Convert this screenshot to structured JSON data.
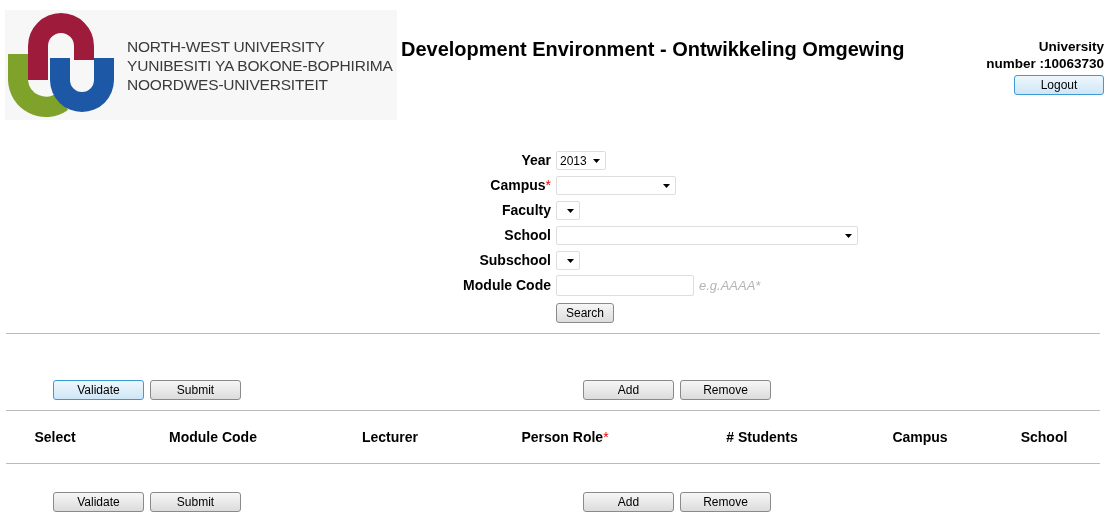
{
  "header": {
    "logo_lines": [
      "NORTH-WEST UNIVERSITY",
      "YUNIBESITI YA BOKONE-BOPHIRIMA",
      "NOORDWES-UNIVERSITEIT"
    ],
    "title": "Development Environment - Ontwikkeling Omgewing",
    "user_label": "University",
    "user_number": "number :10063730",
    "logout": "Logout"
  },
  "form": {
    "fields": [
      {
        "kind": "select",
        "label": "Year",
        "value": "2013"
      },
      {
        "kind": "select",
        "label": "Campus",
        "required_mark": "*"
      },
      {
        "kind": "select",
        "label": "Faculty"
      },
      {
        "kind": "select",
        "label": "School"
      },
      {
        "kind": "select",
        "label": "Subschool"
      },
      {
        "kind": "text",
        "label": "Module Code",
        "hint": "e.g.AAAA*"
      }
    ],
    "search": "Search"
  },
  "toolbar_top": {
    "left": [
      {
        "label": "Validate",
        "focused": true
      },
      {
        "label": "Submit",
        "focused": false
      }
    ],
    "right": [
      {
        "label": "Add",
        "focused": false
      },
      {
        "label": "Remove",
        "focused": false
      }
    ]
  },
  "table": {
    "columns": [
      {
        "label": "Select"
      },
      {
        "label": "Module Code"
      },
      {
        "label": "Lecturer"
      },
      {
        "label": "Person Role",
        "required_mark": "*"
      },
      {
        "label": "# Students"
      },
      {
        "label": "Campus"
      },
      {
        "label": "School"
      }
    ]
  },
  "toolbar_bottom": {
    "left": [
      {
        "label": "Validate",
        "focused": false
      },
      {
        "label": "Submit",
        "focused": false
      }
    ],
    "right": [
      {
        "label": "Add",
        "focused": false
      },
      {
        "label": "Remove",
        "focused": false
      }
    ]
  }
}
